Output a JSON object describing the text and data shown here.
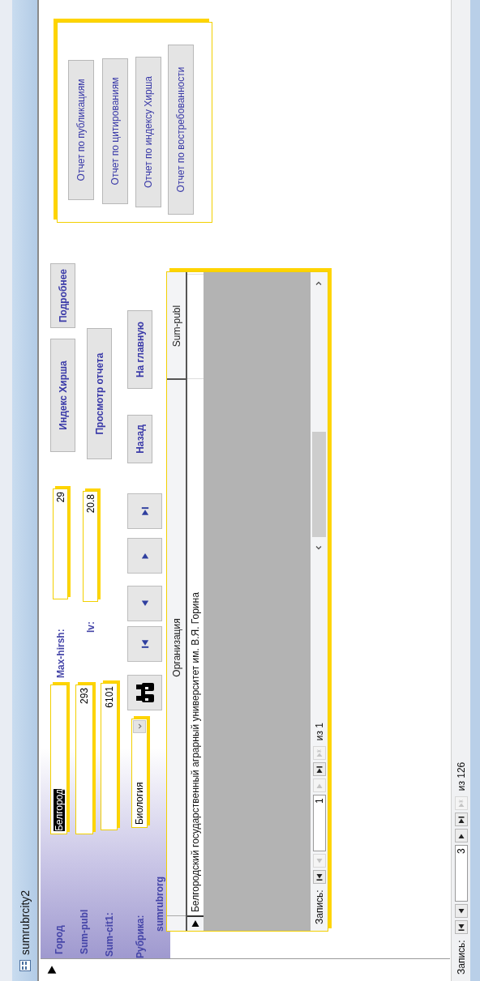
{
  "window": {
    "title": "sumrubrcity2"
  },
  "record_selector": {
    "current": true
  },
  "fields": [
    {
      "label": "Город",
      "value": "Белгород",
      "selected": true
    },
    {
      "label": "Sum-publ",
      "value": "293",
      "selected": false
    },
    {
      "label": "Sum-cit1:",
      "value": "6101",
      "selected": false
    },
    {
      "label": "Max-hirsh:",
      "value": "29",
      "selected": false
    },
    {
      "label": "lv:",
      "value": "20.8",
      "selected": false
    }
  ],
  "rubric": {
    "label": "Рубрика:",
    "value": "Биология"
  },
  "record_buttons": [
    {
      "kind": "first"
    },
    {
      "kind": "prev"
    },
    {
      "kind": "next"
    },
    {
      "kind": "last"
    }
  ],
  "buttons": [
    "Индекс Хирша",
    "Подробнее",
    "Просмотр отчета",
    "Назад",
    "На главную"
  ],
  "subform": {
    "label": "sumrubrorg",
    "columns": [
      "Организация",
      "Sum-publ"
    ],
    "rows": [
      {
        "current": true,
        "cells": [
          "Белгородский государственный аграрный университет им. В.Я. Горина",
          ""
        ]
      }
    ],
    "navigator": {
      "label": "Запись:",
      "current": "1",
      "total": "из 1",
      "buttons": [
        {
          "kind": "first",
          "disabled": false
        },
        {
          "kind": "prev",
          "disabled": true
        },
        {
          "kind": "next",
          "disabled": true
        },
        {
          "kind": "last",
          "disabled": false
        },
        {
          "kind": "new",
          "disabled": true
        }
      ]
    }
  },
  "report_buttons": [
    "Отчет по публикациям",
    "Отчет по цитированиям",
    "Отчет по индексу Хирша",
    "Отчет по востребованности"
  ],
  "navigator": {
    "label": "Запись:",
    "current": "3",
    "total": "из 126",
    "buttons": [
      {
        "kind": "first",
        "disabled": false
      },
      {
        "kind": "prev",
        "disabled": false
      },
      {
        "kind": "next",
        "disabled": false
      },
      {
        "kind": "last",
        "disabled": false
      },
      {
        "kind": "new",
        "disabled": true
      }
    ]
  }
}
